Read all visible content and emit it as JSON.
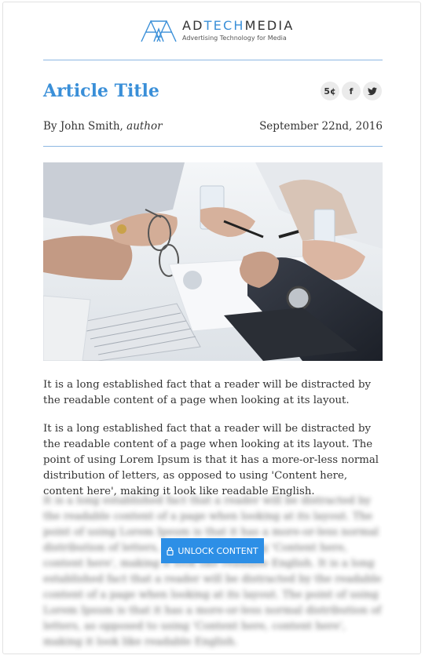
{
  "brand": {
    "name_prefix": "AD",
    "name_highlight": "TECH",
    "name_suffix": "MEDIA",
    "tagline": "Advertising Technology for Media",
    "accent_color": "#3a8fd8"
  },
  "article": {
    "title": "Article Title",
    "author_prefix": "By John Smith, ",
    "author_role": "author",
    "date": "September 22nd, 2016",
    "image_alt_icon": "business-meeting-photo",
    "paragraph_1": "It is a long established fact that a reader will be distracted by the readable content of a page when looking at its layout.",
    "paragraph_2": "It is a long established fact that a reader will be distracted by the readable content of a page when looking at its layout. The point of using Lorem Ipsum is that it has a more-or-less normal distribution of letters, as opposed to using 'Content here, content here', making it look like readable English.",
    "paragraph_locked": "It is a long established fact that a reader will be distracted by the readable content of a page when looking at its layout. The point of using Lorem Ipsum is that it has a more-or-less normal distribution of letters, as opposed to using 'Content here, content here', making it look like readable English. It is a long established fact that a reader will be distracted by the readable content of a page when looking at its layout. The point of using Lorem Ipsum is that it has a more-or-less normal distribution of letters, as opposed to using 'Content here, content here', making it look like readable English."
  },
  "share": {
    "price_label": "5¢",
    "facebook_label": "f",
    "twitter_icon": "twitter-bird-icon"
  },
  "paywall": {
    "button_label": "UNLOCK CONTENT",
    "button_icon": "lock-icon",
    "button_color": "#2d8fe6"
  }
}
